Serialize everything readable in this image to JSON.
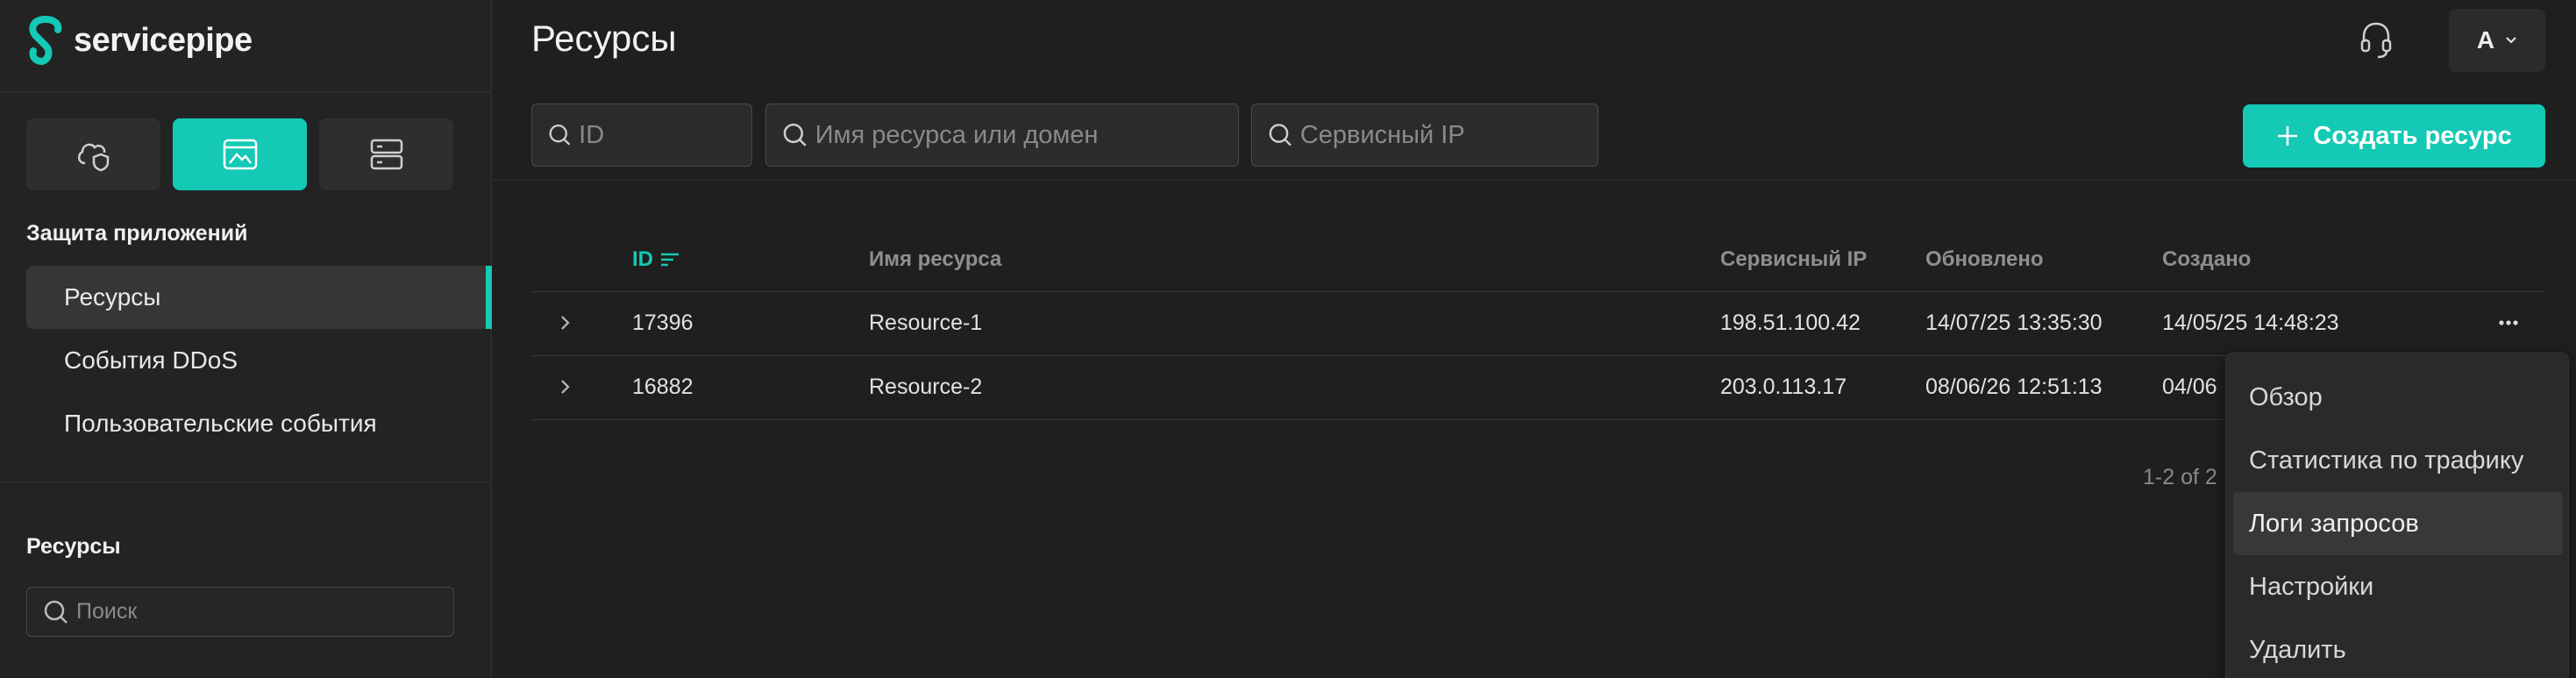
{
  "brand": {
    "name": "servicepipe",
    "accent": "#14c9b5"
  },
  "sidebar": {
    "modes": [
      {
        "icon": "cloud-shield-icon",
        "active": false
      },
      {
        "icon": "app-window-icon",
        "active": true
      },
      {
        "icon": "server-icon",
        "active": false
      }
    ],
    "section_title": "Защита приложений",
    "items": [
      {
        "label": "Ресурсы",
        "active": true
      },
      {
        "label": "События DDoS",
        "active": false
      },
      {
        "label": "Пользовательские события",
        "active": false
      }
    ],
    "resources_title": "Ресурсы",
    "search_placeholder": "Поиск"
  },
  "header": {
    "title": "Ресурсы",
    "account_initial": "A"
  },
  "filters": {
    "id_placeholder": "ID",
    "name_placeholder": "Имя ресурса или домен",
    "ip_placeholder": "Сервисный IP"
  },
  "create_button": "Создать ресурс",
  "table": {
    "columns": {
      "id": "ID",
      "name": "Имя ресурса",
      "ip": "Сервисный IP",
      "updated": "Обновлено",
      "created": "Создано"
    },
    "rows": [
      {
        "id": "17396",
        "name": "Resource-1",
        "ip": "198.51.100.42",
        "updated": "14/07/25 13:35:30",
        "created": "14/05/25 14:48:23"
      },
      {
        "id": "16882",
        "name": "Resource-2",
        "ip": "203.0.113.17",
        "updated": "08/06/26 12:51:13",
        "created": "04/06"
      }
    ],
    "pagination": "1-2 of 2"
  },
  "row_menu": {
    "items": [
      "Обзор",
      "Статистика по трафику",
      "Логи запросов",
      "Настройки",
      "Удалить"
    ],
    "highlighted": "Логи запросов"
  }
}
